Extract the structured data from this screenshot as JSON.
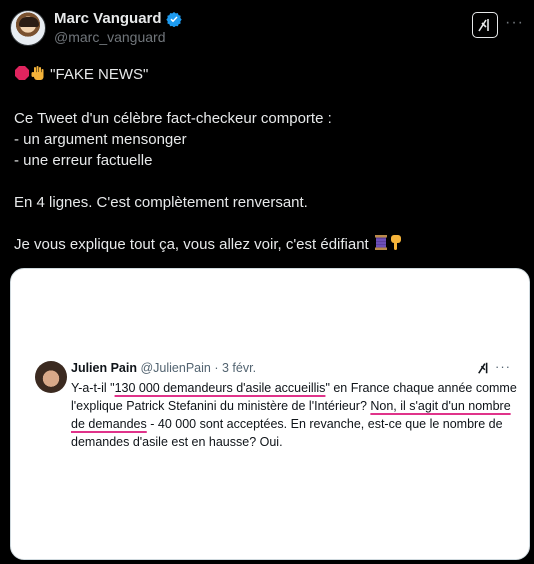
{
  "author": {
    "display_name": "Marc Vanguard",
    "handle": "@marc_vanguard",
    "verified": true
  },
  "header_actions": {
    "grok_icon": "grok-icon",
    "more": "···"
  },
  "tweet": {
    "line1": "\"FAKE NEWS\"",
    "para2": "Ce Tweet d'un célèbre fact-checkeur comporte :\n- un argument mensonger\n- une erreur factuelle",
    "para3": "En 4 lignes. C'est complètement renversant.",
    "para4": "Je vous explique tout ça, vous allez voir, c'est édifiant"
  },
  "quoted": {
    "name": "Julien Pain",
    "handle": "@JulienPain",
    "separator": "·",
    "date": "3 févr.",
    "more": "···",
    "t1": "Y-a-t-il \"",
    "t2": "130 000 demandeurs d'asile accueillis",
    "t3": "\" en France chaque année comme l'explique Patrick Stefanini du ministère de l'Intérieur? ",
    "t4": "Non, il s'agit d'un nombre de demandes",
    "t5": " - 40 000 sont acceptées. En revanche, est-ce que le nombre de demandes d'asile est en hausse? Oui."
  },
  "colors": {
    "background": "#000000",
    "text": "#e7e9ea",
    "muted": "#71767b",
    "verified": "#1d9bf0",
    "highlight": "#e0338a"
  }
}
